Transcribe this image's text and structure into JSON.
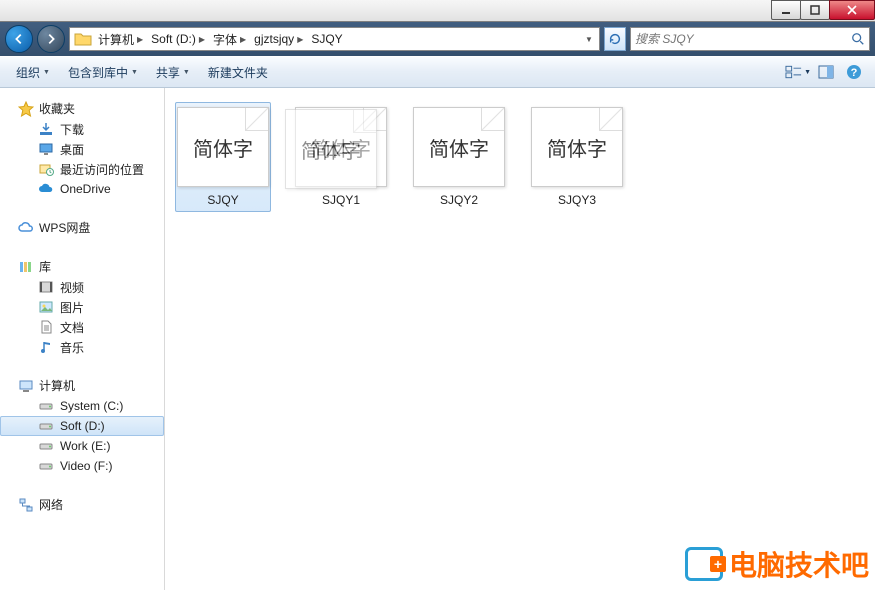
{
  "window": {
    "buttons": {
      "minimize": "minimize",
      "maximize": "maximize",
      "close": "close"
    }
  },
  "breadcrumbs": [
    "计算机",
    "Soft (D:)",
    "字体",
    "gjztsjqy",
    "SJQY"
  ],
  "search": {
    "placeholder": "搜索 SJQY"
  },
  "toolbar": {
    "organize": "组织",
    "include_in_library": "包含到库中",
    "share": "共享",
    "new_folder": "新建文件夹"
  },
  "sidebar": {
    "favorites": {
      "label": "收藏夹",
      "items": [
        "下载",
        "桌面",
        "最近访问的位置",
        "OneDrive"
      ]
    },
    "wps": {
      "label": "WPS网盘"
    },
    "libraries": {
      "label": "库",
      "items": [
        "视频",
        "图片",
        "文档",
        "音乐"
      ]
    },
    "computer": {
      "label": "计算机",
      "items": [
        "System (C:)",
        "Soft (D:)",
        "Work (E:)",
        "Video (F:)"
      ],
      "selected_index": 1
    },
    "network": {
      "label": "网络"
    }
  },
  "files": {
    "thumb_text": "简体字",
    "items": [
      {
        "name": "SJQY",
        "selected": true
      },
      {
        "name": "SJQY1",
        "selected": false
      },
      {
        "name": "SJQY2",
        "selected": false
      },
      {
        "name": "SJQY3",
        "selected": false
      }
    ]
  },
  "watermark": "电脑技术吧"
}
